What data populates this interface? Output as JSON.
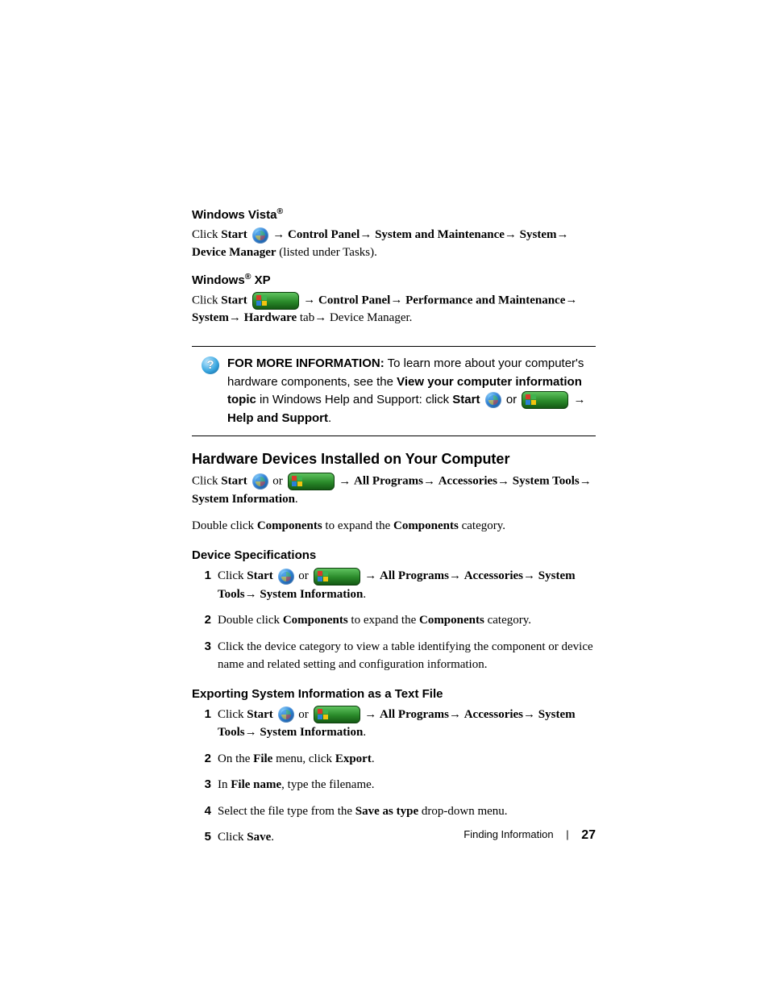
{
  "vista": {
    "heading_pre": "Windows Vista",
    "reg": "®",
    "click": "Click ",
    "start": "Start",
    "path1": "Control Panel",
    "path2": "System and Maintenance",
    "path3": "System",
    "path4": "Device Manager",
    "tail": " (listed under Tasks)."
  },
  "xp": {
    "heading_pre": "Windows",
    "reg": "®",
    "heading_post": " XP",
    "click": "Click ",
    "start": "Start",
    "path1": "Control Panel",
    "path2": "Performance and Maintenance",
    "path3": "System",
    "path4": "Hardware",
    "tab": " tab",
    "path5": "Device Manager",
    "period": "."
  },
  "info": {
    "lead": "FOR MORE INFORMATION:",
    "t1": " To learn more about your computer's hardware components, see the ",
    "topic": "View your computer information topic",
    "t2": " in Windows Help and Support: click ",
    "start": "Start",
    "or": " or ",
    "help": "Help and Support",
    "period": "."
  },
  "hw": {
    "heading": "Hardware Devices Installed on Your Computer",
    "click": "Click ",
    "start": "Start",
    "or": "  or  ",
    "p1": "All Programs",
    "p2": "Accessories",
    "p3": "System Tools",
    "p4": "System Information",
    "period": ".",
    "dbl1": "Double click ",
    "components1": "Components",
    "dbl2": " to expand the ",
    "components2": "Components",
    "dbl3": " category."
  },
  "devspec": {
    "heading": "Device Specifications",
    "s1_click": "Click ",
    "s1_start": "Start",
    "s1_or": "  or  ",
    "s1_p1": "All Programs",
    "s1_p2": "Accessories",
    "s1_p3": "System Tools",
    "s1_p4": "System Information",
    "s1_period": ".",
    "s2a": "Double click ",
    "s2b": "Components",
    "s2c": " to expand the ",
    "s2d": "Components",
    "s2e": " category.",
    "s3": "Click the device category to view a table identifying the component or device name and related setting and configuration information."
  },
  "export": {
    "heading": "Exporting System Information as a Text File",
    "s1_click": "Click ",
    "s1_start": "Start",
    "s1_or": "  or  ",
    "s1_p1": "All Programs",
    "s1_p2": "Accessories",
    "s1_p3": "System Tools",
    "s1_p4": "System Information",
    "s1_period": ".",
    "s2a": "On the ",
    "s2b": "File",
    "s2c": " menu, click ",
    "s2d": "Export",
    "s2e": ".",
    "s3a": "In ",
    "s3b": "File name",
    "s3c": ", type the filename.",
    "s4a": "Select the file type from the ",
    "s4b": "Save as type",
    "s4c": " drop-down menu.",
    "s5a": "Click ",
    "s5b": "Save",
    "s5c": "."
  },
  "nums": {
    "n1": "1",
    "n2": "2",
    "n3": "3",
    "n4": "4",
    "n5": "5"
  },
  "footer": {
    "label": "Finding Information",
    "page": "27"
  }
}
